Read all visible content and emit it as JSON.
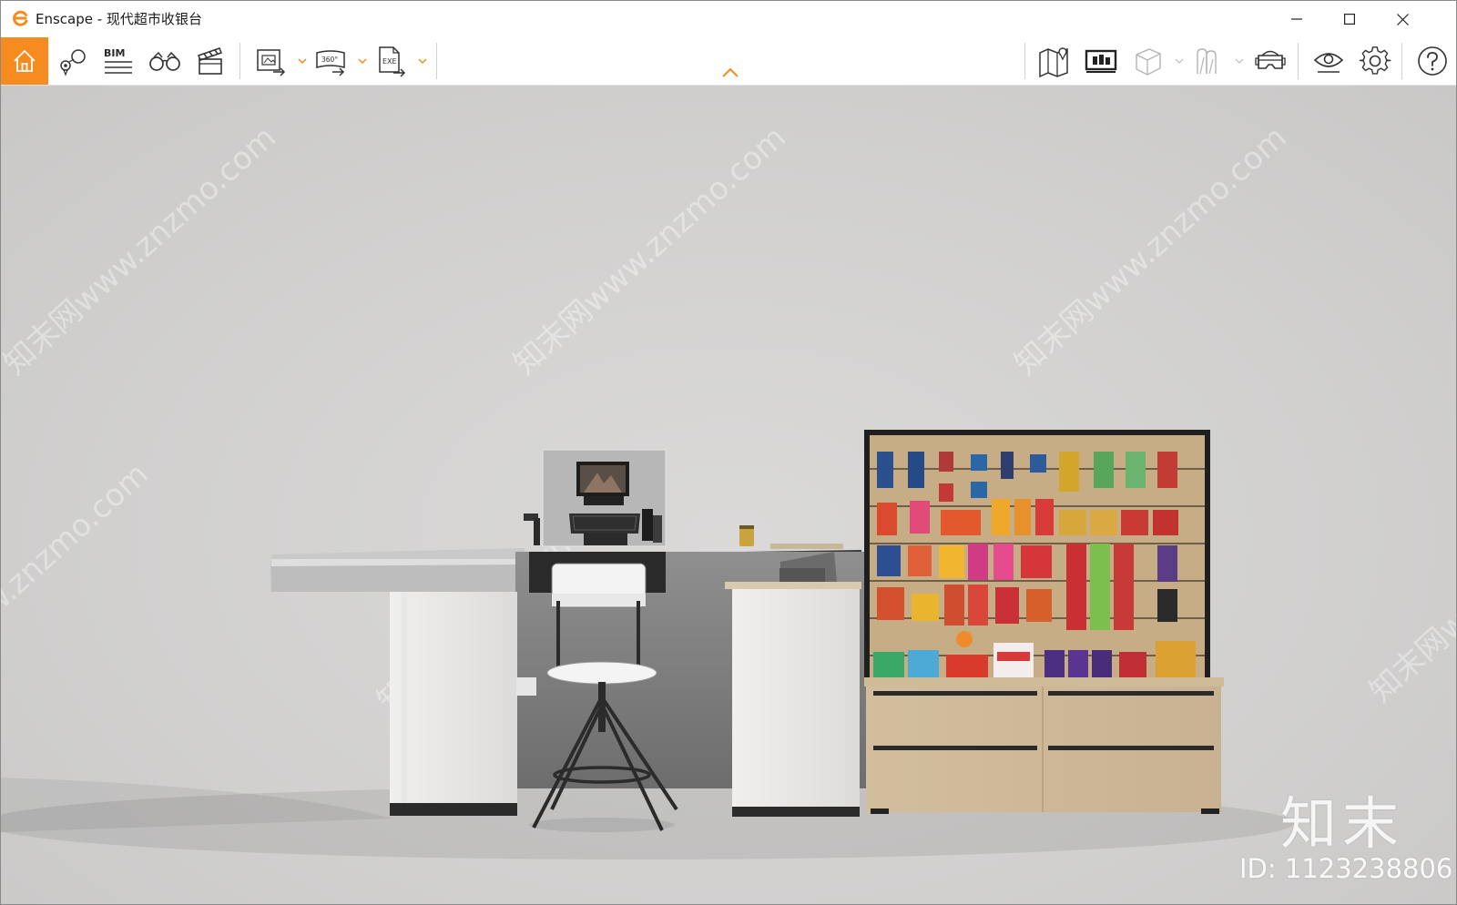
{
  "window": {
    "title": "Enscape - 现代超市收银台",
    "controls": [
      "minimize",
      "maximize",
      "close"
    ]
  },
  "toolbar": {
    "accent_color": "#f68b1f",
    "left_tools": [
      {
        "name": "home",
        "icon": "home-icon",
        "active": true
      },
      {
        "name": "views",
        "icon": "location-pin-icon"
      },
      {
        "name": "bim",
        "icon": "bim-icon",
        "label": "BIM"
      },
      {
        "name": "walk",
        "icon": "binoculars-icon"
      },
      {
        "name": "video-editor",
        "icon": "clapperboard-icon"
      },
      {
        "name": "batch-render",
        "icon": "image-export-icon",
        "has_dropdown": true
      },
      {
        "name": "panorama",
        "icon": "panorama-export-icon",
        "label": "360°",
        "has_dropdown": true
      },
      {
        "name": "exe-export",
        "icon": "exe-export-icon",
        "label": "EXE",
        "has_dropdown": true
      }
    ],
    "right_tools": [
      {
        "name": "map",
        "icon": "map-icon"
      },
      {
        "name": "asset-library",
        "icon": "monitor-library-icon"
      },
      {
        "name": "cube",
        "icon": "cube-icon",
        "disabled": true,
        "has_dropdown": true
      },
      {
        "name": "sections",
        "icon": "section-icon",
        "disabled": true,
        "has_dropdown": true
      },
      {
        "name": "vr",
        "icon": "vr-headset-icon"
      },
      {
        "name": "visual-settings",
        "icon": "eye-icon"
      },
      {
        "name": "settings",
        "icon": "gear-icon"
      },
      {
        "name": "help",
        "icon": "help-icon"
      }
    ]
  },
  "viewport": {
    "background_color": "#d6d5d4",
    "watermark_text": "知末网www.znzmo.com",
    "brand_mark": "知末",
    "id_label": "ID: 1123238806"
  }
}
